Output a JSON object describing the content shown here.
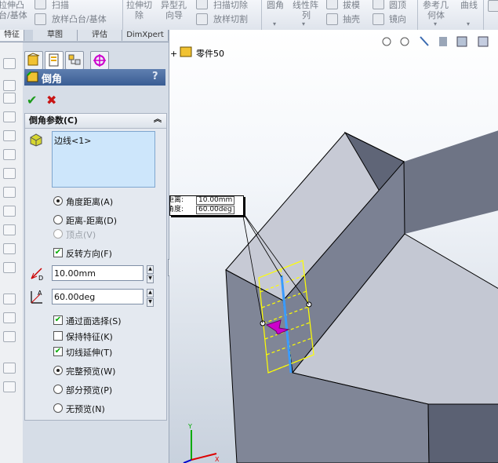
{
  "ribbon": {
    "items": [
      {
        "label": "拉伸凸"
      },
      {
        "label": "台/基体"
      },
      {
        "label": "扫描"
      },
      {
        "label": "放样凸台/基体"
      },
      {
        "label": "拉伸切"
      },
      {
        "label": "除"
      },
      {
        "label": "异型孔"
      },
      {
        "label": "向导"
      },
      {
        "label": "扫描切除"
      },
      {
        "label": "放样切割"
      },
      {
        "label": "圆角"
      },
      {
        "label": "线性阵"
      },
      {
        "label": "列"
      },
      {
        "label": "拔模"
      },
      {
        "label": "抽壳"
      },
      {
        "label": "圆顶"
      },
      {
        "label": "镜向"
      },
      {
        "label": "参考几"
      },
      {
        "label": "何体"
      },
      {
        "label": "曲线"
      }
    ]
  },
  "tabs": [
    "特征",
    "草图",
    "评估",
    "DimXpert"
  ],
  "panel": {
    "title": "倒角",
    "help": "?",
    "ok": "✔",
    "cancel": "✖",
    "group_header": "倒角参数(C)",
    "collapse": "⌃",
    "selection": "边线<1>",
    "type_options": [
      {
        "label": "角度距离(A)",
        "selected": true,
        "enabled": true
      },
      {
        "label": "距离-距离(D)",
        "selected": false,
        "enabled": true
      },
      {
        "label": "顶点(V)",
        "selected": false,
        "enabled": false
      }
    ],
    "flip": {
      "label": "反转方向(F)",
      "checked": true
    },
    "distance": {
      "value": "10.00mm",
      "label": "D"
    },
    "angle": {
      "value": "60.00deg",
      "label": "A"
    },
    "options": [
      {
        "label": "通过面选择(S)",
        "checked": true
      },
      {
        "label": "保持特征(K)",
        "checked": false
      },
      {
        "label": "切线延伸(T)",
        "checked": true
      }
    ],
    "preview": [
      {
        "label": "完整预览(W)",
        "selected": true
      },
      {
        "label": "部分预览(P)",
        "selected": false
      },
      {
        "label": "无预览(N)",
        "selected": false
      }
    ]
  },
  "viewport": {
    "part_name": "零件50",
    "callout_distance_label": "距离:",
    "callout_distance": "10.00mm",
    "callout_angle_label": "角度:",
    "callout_angle": "60.00deg",
    "axis_y": "Y",
    "axis_x": "X"
  },
  "colors": {
    "body": "#7e8496",
    "preview": "#ffff00",
    "edge": "#3a9bff",
    "arrow": "#cc00cc"
  }
}
